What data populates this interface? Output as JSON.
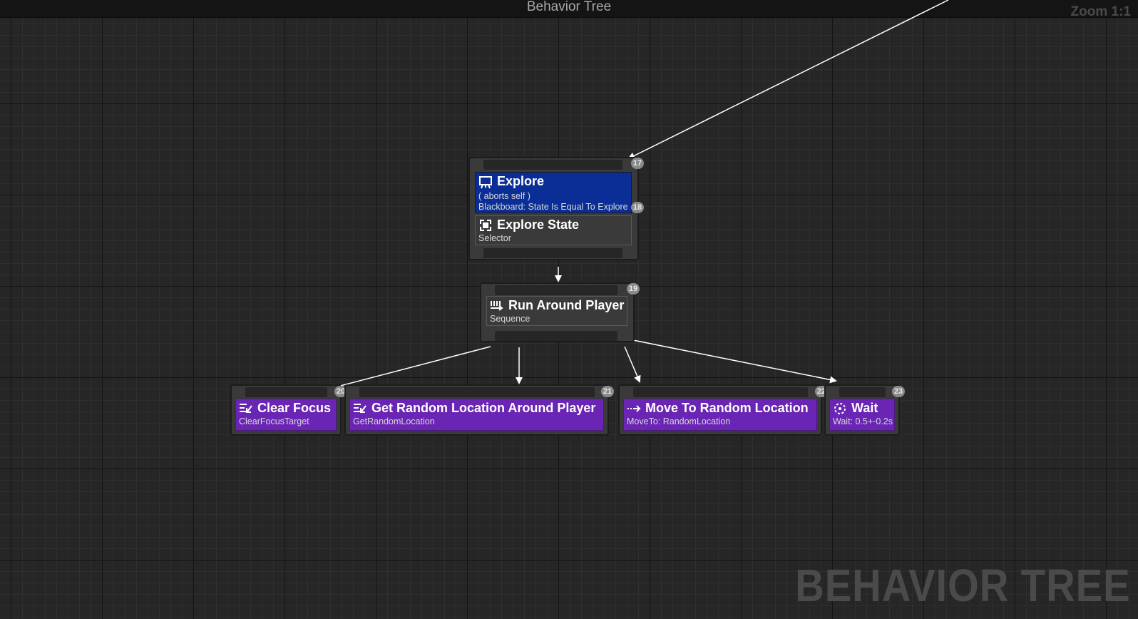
{
  "window": {
    "title": "Behavior Tree",
    "zoom": "Zoom 1:1",
    "watermark": "BEHAVIOR TREE"
  },
  "nodes": {
    "explore": {
      "index": "17",
      "decorator": {
        "title": "Explore",
        "aborts": "( aborts self )",
        "detail": "Blackboard: State Is Equal To Explore",
        "index": "18",
        "icon": "blackboard-icon"
      },
      "composite": {
        "title": "Explore State",
        "type": "Selector",
        "icon": "selector-icon"
      }
    },
    "run_around": {
      "index": "19",
      "title": "Run Around Player",
      "type": "Sequence",
      "icon": "sequence-icon"
    },
    "tasks": [
      {
        "index": "20",
        "title": "Clear Focus",
        "sub": "ClearFocusTarget",
        "icon": "task-icon"
      },
      {
        "index": "21",
        "title": "Get Random Location Around Player",
        "sub": "GetRandomLocation",
        "icon": "task-icon"
      },
      {
        "index": "22",
        "title": "Move To Random Location",
        "sub": "MoveTo: RandomLocation",
        "icon": "move-to-icon"
      },
      {
        "index": "23",
        "title": "Wait",
        "sub": "Wait: 0.5+-0.2s",
        "icon": "wait-icon"
      }
    ]
  },
  "colors": {
    "background": "#262626",
    "decorator": "#0a2e95",
    "composite": "#3a3a3a",
    "task": "#6a25b4",
    "wire": "#ffffff"
  }
}
